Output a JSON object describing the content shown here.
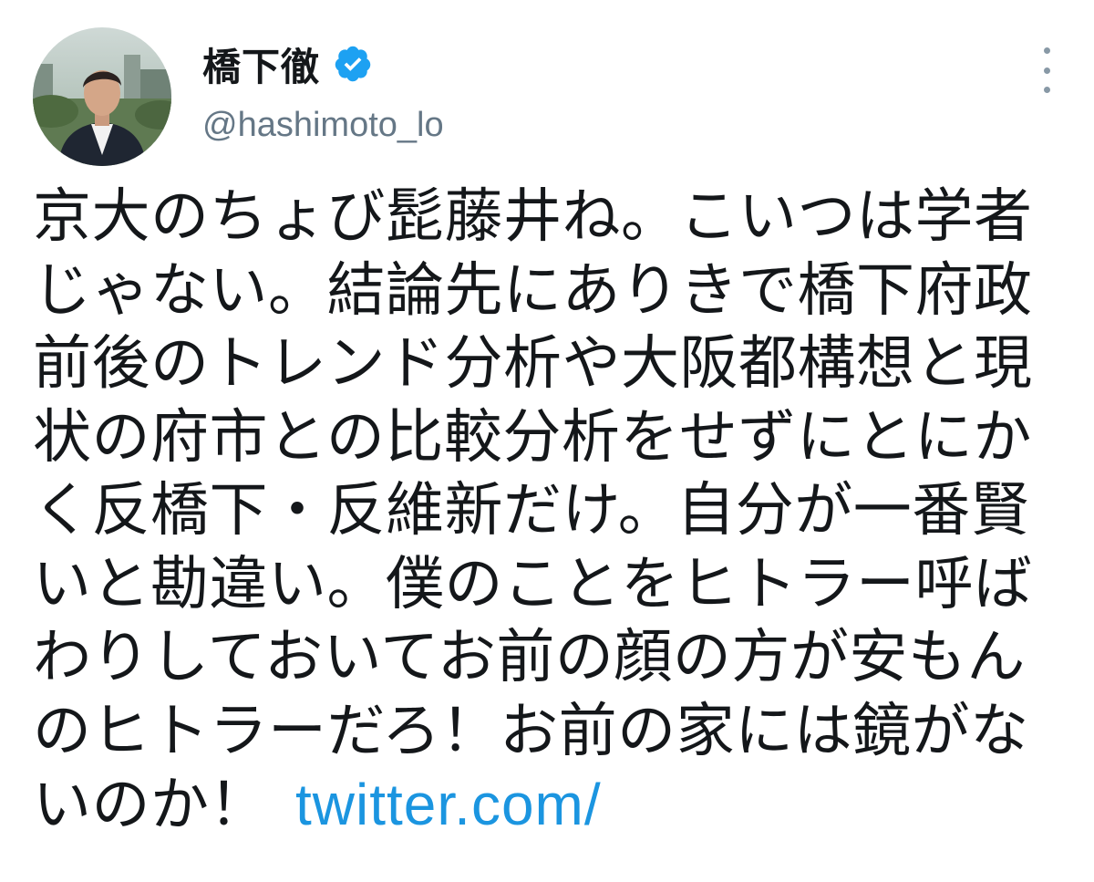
{
  "author": {
    "display_name": "橋下徹",
    "handle": "@hashimoto_lo",
    "verified": true,
    "avatar_icon": "profile-photo"
  },
  "menu": {
    "more_icon": "vertical-ellipsis-icon"
  },
  "tweet": {
    "lines": [
      "京大のちょび髭藤井ね。こいつは学者",
      "じゃない。結論先にありきで橋下府政",
      "前後のトレンド分析や大阪都構想と現",
      "状の府市との比較分析をせずにとにか",
      "く反橋下・反維新だけ。自分が一番賢",
      "いと勘違い。僕のことをヒトラー呼ば",
      "わりしておいてお前の顔の方が安もん",
      "のヒトラーだろ！お前の家には鏡がな"
    ],
    "last_line_text": "いのか！",
    "link_text": "twitter.com/"
  },
  "colors": {
    "text": "#14171a",
    "secondary": "#657786",
    "link": "#1b95e0",
    "verified_badge": "#1da1f2"
  }
}
